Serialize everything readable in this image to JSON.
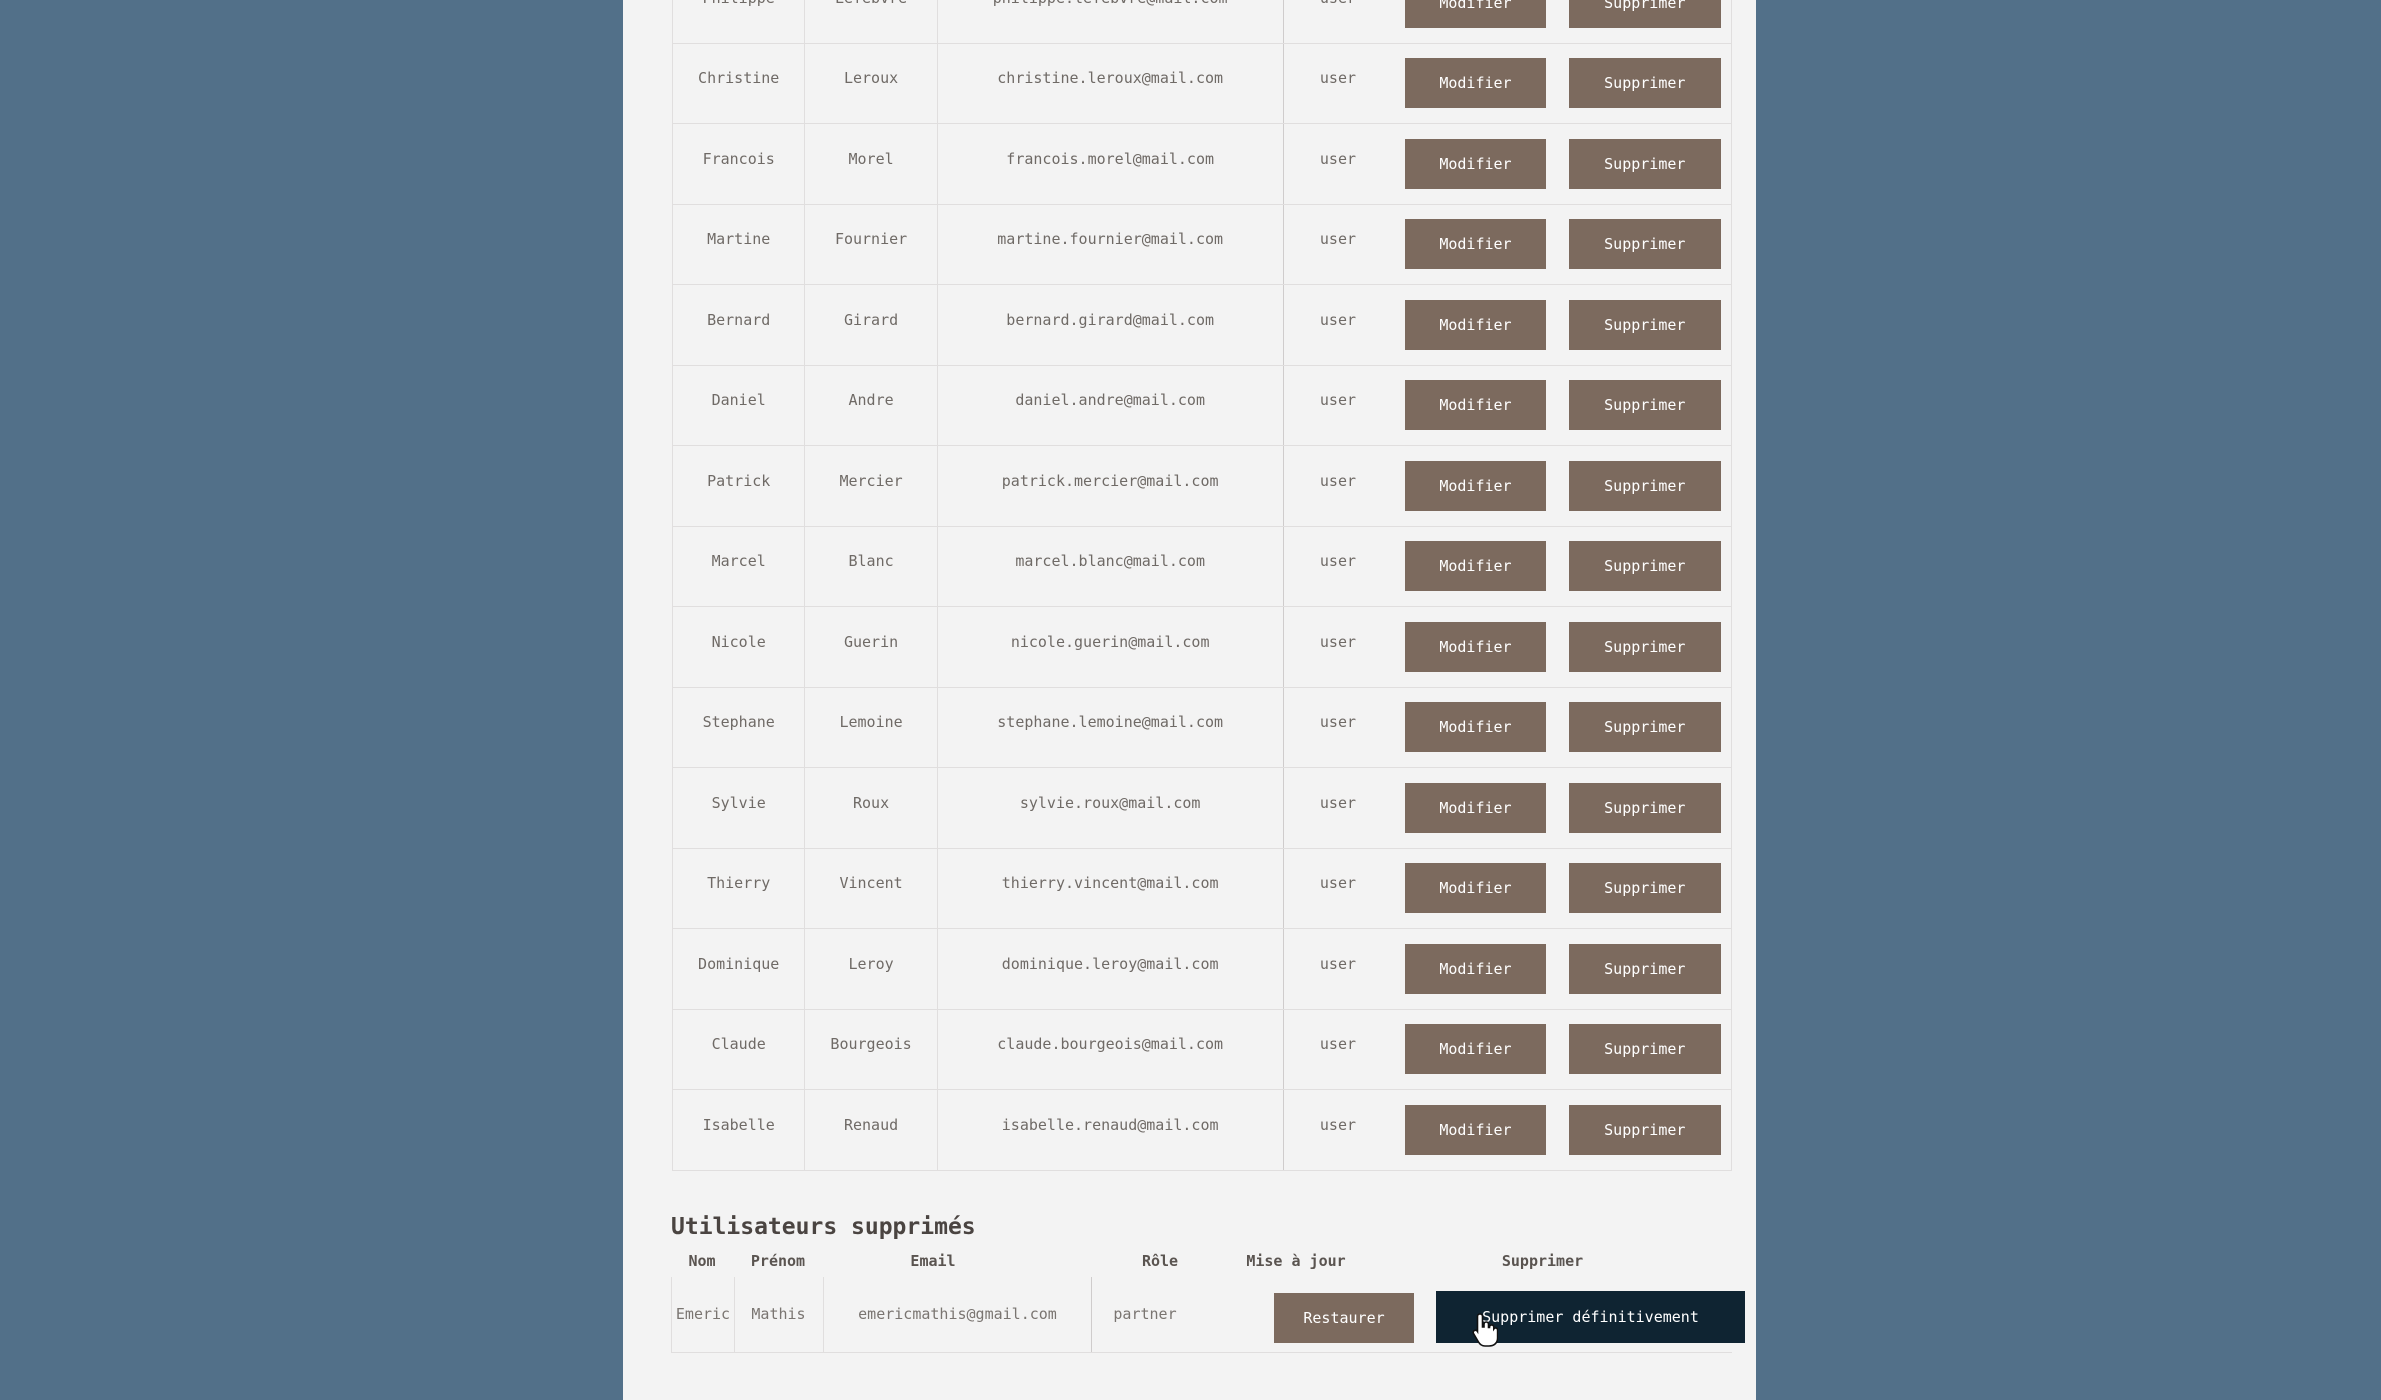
{
  "users": {
    "action_modify": "Modifier",
    "action_delete": "Supprimer",
    "rows": [
      {
        "nom": "Philippe",
        "prenom": "Lefebvre",
        "email": "philippe.lefebvre@mail.com",
        "role": "user"
      },
      {
        "nom": "Christine",
        "prenom": "Leroux",
        "email": "christine.leroux@mail.com",
        "role": "user"
      },
      {
        "nom": "Francois",
        "prenom": "Morel",
        "email": "francois.morel@mail.com",
        "role": "user"
      },
      {
        "nom": "Martine",
        "prenom": "Fournier",
        "email": "martine.fournier@mail.com",
        "role": "user"
      },
      {
        "nom": "Bernard",
        "prenom": "Girard",
        "email": "bernard.girard@mail.com",
        "role": "user"
      },
      {
        "nom": "Daniel",
        "prenom": "Andre",
        "email": "daniel.andre@mail.com",
        "role": "user"
      },
      {
        "nom": "Patrick",
        "prenom": "Mercier",
        "email": "patrick.mercier@mail.com",
        "role": "user"
      },
      {
        "nom": "Marcel",
        "prenom": "Blanc",
        "email": "marcel.blanc@mail.com",
        "role": "user"
      },
      {
        "nom": "Nicole",
        "prenom": "Guerin",
        "email": "nicole.guerin@mail.com",
        "role": "user"
      },
      {
        "nom": "Stephane",
        "prenom": "Lemoine",
        "email": "stephane.lemoine@mail.com",
        "role": "user"
      },
      {
        "nom": "Sylvie",
        "prenom": "Roux",
        "email": "sylvie.roux@mail.com",
        "role": "user"
      },
      {
        "nom": "Thierry",
        "prenom": "Vincent",
        "email": "thierry.vincent@mail.com",
        "role": "user"
      },
      {
        "nom": "Dominique",
        "prenom": "Leroy",
        "email": "dominique.leroy@mail.com",
        "role": "user"
      },
      {
        "nom": "Claude",
        "prenom": "Bourgeois",
        "email": "claude.bourgeois@mail.com",
        "role": "user"
      },
      {
        "nom": "Isabelle",
        "prenom": "Renaud",
        "email": "isabelle.renaud@mail.com",
        "role": "user"
      }
    ]
  },
  "deleted": {
    "title": "Utilisateurs supprimés",
    "headers": {
      "nom": "Nom",
      "prenom": "Prénom",
      "email": "Email",
      "role": "Rôle",
      "update": "Mise à jour",
      "delete": "Supprimer"
    },
    "row": {
      "nom": "Emeric",
      "prenom": "Mathis",
      "email": "emericmathis@gmail.com",
      "role": "partner"
    },
    "restore_label": "Restaurer",
    "delete_permanently_label": "Supprimer définitivement"
  },
  "colors": {
    "background": "#527089",
    "panel": "#f3f3f3",
    "action_button": "#7c6a5e",
    "danger_button": "#0f2432"
  },
  "icons": {
    "cursor": "hand-pointer-icon"
  }
}
